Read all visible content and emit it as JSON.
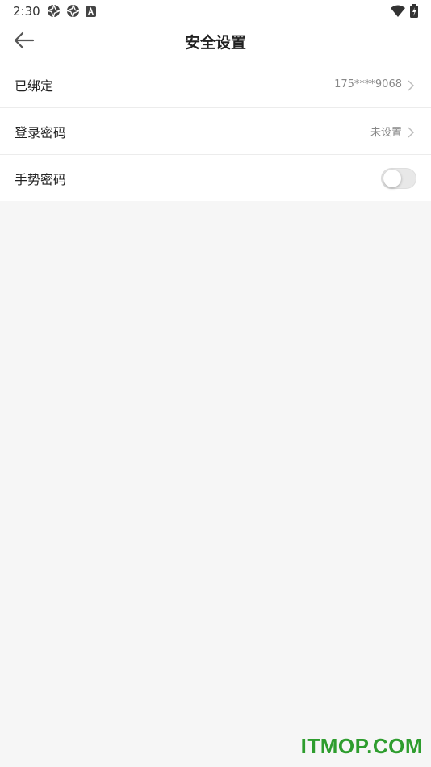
{
  "status_bar": {
    "time": "2:30",
    "left_icons": [
      "aperture-icon",
      "aperture-icon",
      "a-icon"
    ],
    "right_icons": [
      "wifi-icon",
      "battery-icon"
    ]
  },
  "header": {
    "title": "安全设置",
    "back_icon": "arrow-left-icon"
  },
  "settings": {
    "items": [
      {
        "label": "已绑定",
        "value": "175****9068",
        "type": "link"
      },
      {
        "label": "登录密码",
        "value": "未设置",
        "type": "link"
      },
      {
        "label": "手势密码",
        "type": "toggle",
        "enabled": false
      }
    ]
  },
  "watermark": {
    "text": "ITMOP.COM",
    "color": "#2e9d2e"
  }
}
